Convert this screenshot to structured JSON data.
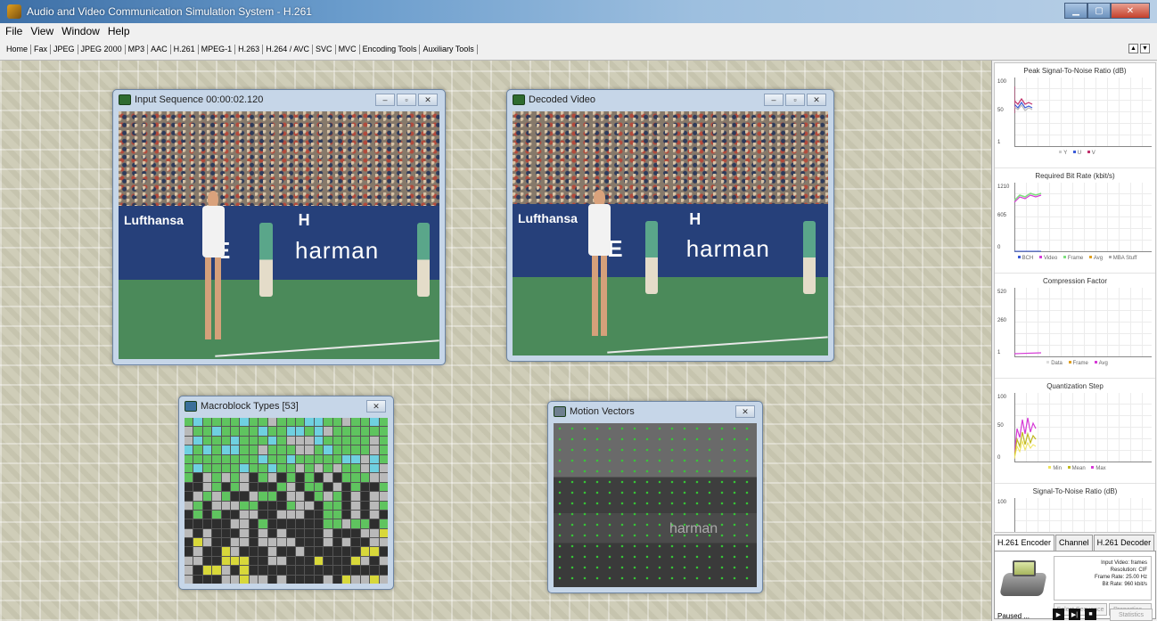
{
  "window": {
    "title": "Audio and Video Communication Simulation System - H.261"
  },
  "menu": [
    "File",
    "View",
    "Window",
    "Help"
  ],
  "toolbar": [
    "Home",
    "Fax",
    "JPEG",
    "JPEG 2000",
    "MP3",
    "AAC",
    "H.261",
    "MPEG-1",
    "H.263",
    "H.264 / AVC",
    "SVC",
    "MVC",
    "Encoding Tools",
    "Auxiliary Tools"
  ],
  "windows": {
    "input": {
      "title": "Input Sequence 00:00:02.120"
    },
    "decoded": {
      "title": "Decoded Video"
    },
    "macroblock": {
      "title": "Macroblock Types [53]"
    },
    "motion": {
      "title": "Motion Vectors"
    }
  },
  "scene": {
    "sponsor1": "Lufthansa",
    "sponsor2": "harman",
    "letter": "H",
    "el": "E"
  },
  "mv_overlay": "harman",
  "graphs": [
    {
      "title": "Peak Signal-To-Noise Ratio (dB)",
      "ymax": "100",
      "ymid": "50",
      "ymin": "1",
      "legend": [
        "Y",
        "U",
        "V"
      ]
    },
    {
      "title": "Required Bit Rate (kbit/s)",
      "ymax": "1210",
      "ymid": "605",
      "ymin": "0",
      "legend": [
        "BCH",
        "Video",
        "Frame",
        "Avg",
        "MBA Stuff"
      ]
    },
    {
      "title": "Compression Factor",
      "ymax": "520",
      "ymid": "260",
      "ymin": "1",
      "legend": [
        "Data",
        "Frame",
        "Avg"
      ]
    },
    {
      "title": "Quantization Step",
      "ymax": "100",
      "ymid": "50",
      "ymin": "0",
      "legend": [
        "Min",
        "Mean",
        "Max"
      ]
    },
    {
      "title": "Signal-To-Noise Ratio (dB)",
      "ymax": "100"
    }
  ],
  "tabs": [
    "H.261 Encoder",
    "Channel",
    "H.261 Decoder"
  ],
  "encoder": {
    "info": [
      "Input Video: frames",
      "Resolution: CIF",
      "Frame Rate: 25.00 Hz",
      "Bit Rate: 960 kbit/s"
    ],
    "select_label": "Select Sequence",
    "properties_label": "Properties...",
    "statistics_label": "Statistics",
    "status": "Paused ..."
  },
  "colors": {
    "accent": "#3d6fa6",
    "psnr_y": "#e0e0e0",
    "psnr_u": "#3a5ad8",
    "psnr_v": "#c0306b",
    "bitrate_green": "#7ee07e",
    "bitrate_magenta": "#d63ad6"
  }
}
